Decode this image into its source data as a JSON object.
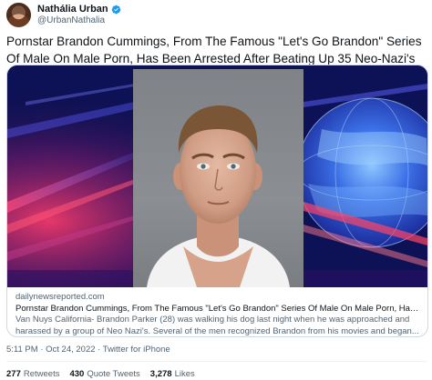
{
  "author": {
    "display_name": "Nathália Urban",
    "handle": "@UrbanNathalia",
    "verified": true
  },
  "tweet": {
    "text": "Pornstar Brandon Cummings, From The Famous \"Let's Go Brandon\" Series Of Male On Male Porn, Has Been Arrested After Beating Up 35 Neo-Nazi's",
    "timestamp": "5:11 PM · Oct 24, 2022 · Twitter for iPhone"
  },
  "card": {
    "domain": "dailynewsreported.com",
    "title": "Pornstar Brandon Cummings, From The Famous \"Let's Go Brandon\" Series Of Male On Male Porn, Has Been...",
    "description": "Van Nuys California- Brandon Parker (28) was walking his dog last night when he was approached and harassed by a group of Neo Nazi's. Several of the men recognized Brandon from his movies and began..."
  },
  "stats": {
    "retweets_count": "277",
    "retweets_label": "Retweets",
    "quotes_count": "430",
    "quotes_label": "Quote Tweets",
    "likes_count": "3,278",
    "likes_label": "Likes"
  },
  "colors": {
    "verified_blue": "#1d9bf0",
    "secondary_text": "#536471",
    "card_border": "#cfd9de"
  }
}
